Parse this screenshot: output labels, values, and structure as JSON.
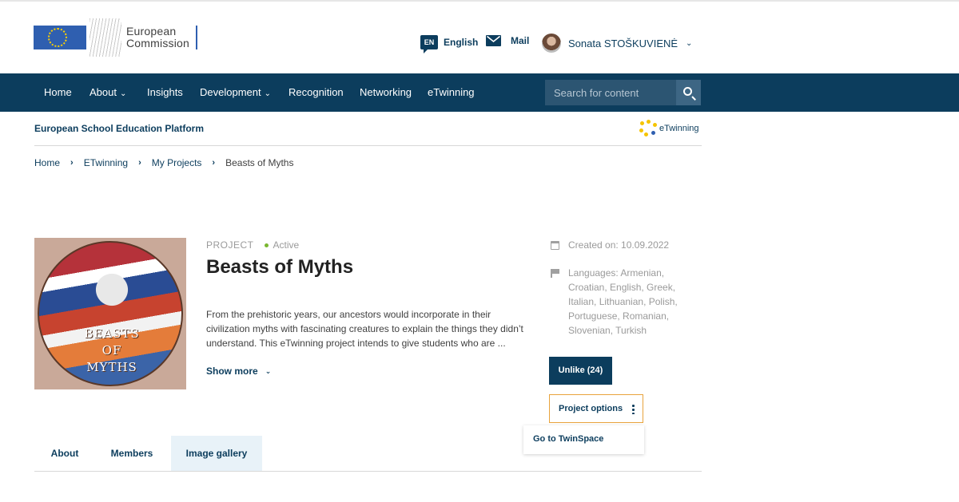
{
  "header": {
    "logo_line1": "European",
    "logo_line2": "Commission",
    "language_code": "EN",
    "language_label": "English",
    "mail_label": "Mail",
    "user_name": "Sonata STOŠKUVIENĖ"
  },
  "nav": {
    "items": [
      {
        "label": "Home",
        "has_dropdown": false
      },
      {
        "label": "About",
        "has_dropdown": true
      },
      {
        "label": "Insights",
        "has_dropdown": false
      },
      {
        "label": "Development",
        "has_dropdown": true
      },
      {
        "label": "Recognition",
        "has_dropdown": false
      },
      {
        "label": "Networking",
        "has_dropdown": false
      },
      {
        "label": "eTwinning",
        "has_dropdown": false
      }
    ],
    "search_placeholder": "Search for content"
  },
  "subheader": {
    "platform_title": "European School Education Platform",
    "brand_label": "eTwinning"
  },
  "breadcrumb": {
    "items": [
      "Home",
      "ETwinning",
      "My Projects"
    ],
    "current": "Beasts of Myths"
  },
  "project": {
    "type": "PROJECT",
    "status": "Active",
    "title": "Beasts of Myths",
    "image_text": "BEASTS OF MYTHS",
    "description": "From the prehistoric years, our ancestors would incorporate in their civilization myths with fascinating creatures to explain the things they didn’t understand. This eTwinning project intends to give students who are ...",
    "show_more_label": "Show more",
    "created_on": "Created on: 10.09.2022",
    "languages": "Languages: Armenian, Croatian, English, Greek, Italian, Lithuanian, Polish, Portuguese, Romanian, Slovenian, Turkish",
    "unlike_label": "Unlike (24)",
    "options_label": "Project options",
    "dropdown_item": "Go to TwinSpace"
  },
  "tabs": [
    "About",
    "Members",
    "Image gallery"
  ],
  "active_tab": "Image gallery",
  "colors": {
    "primary": "#0c3d5d",
    "accent_border": "#e8a33c",
    "status_active": "#7ab730"
  }
}
